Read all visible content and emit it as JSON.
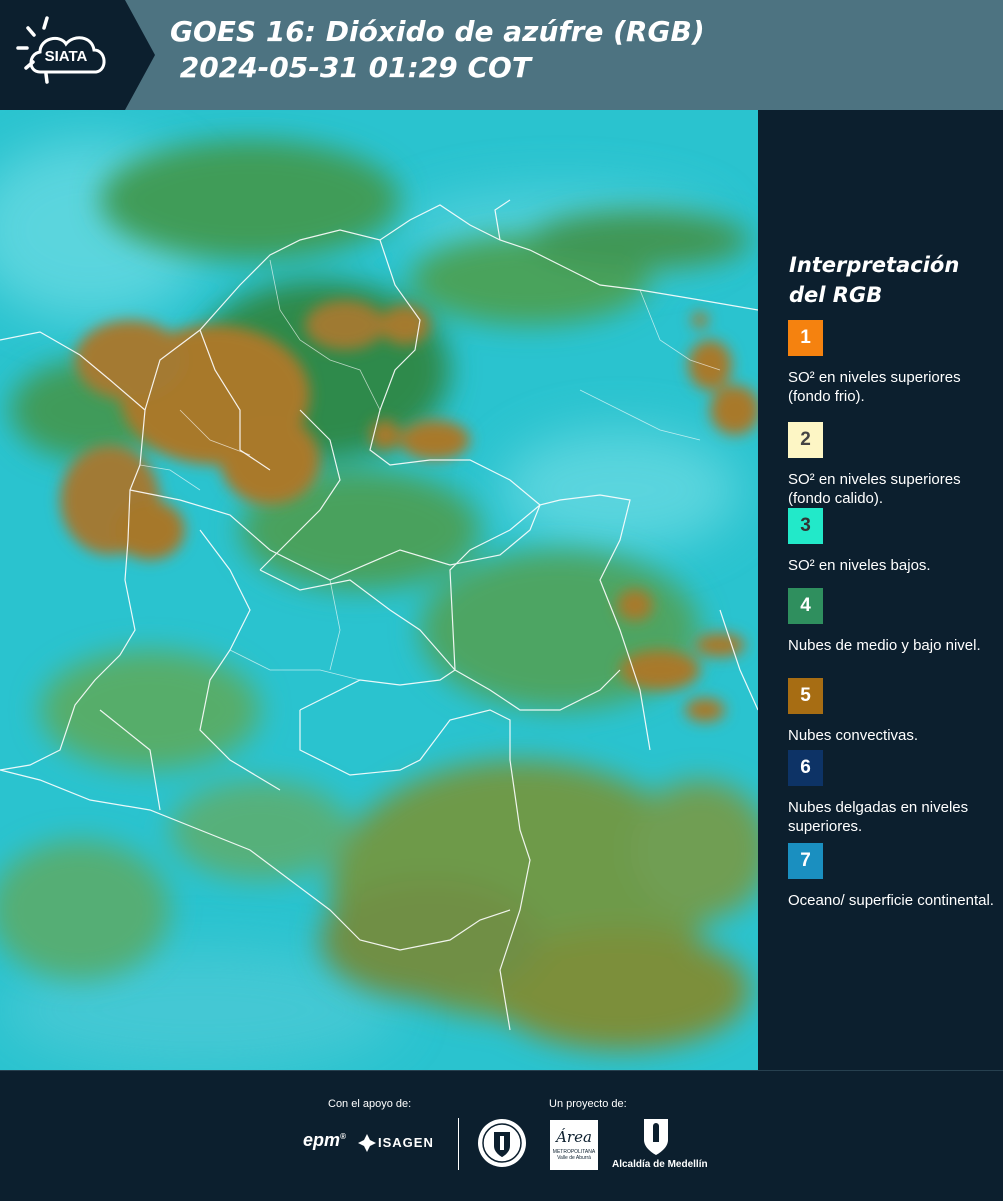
{
  "header": {
    "logo_text": "SIATA",
    "title_line1": "GOES 16: Dióxido de azúfre (RGB)",
    "title_line2": " 2024-05-31 01:29 COT"
  },
  "legend": {
    "title": "Interpretación del RGB",
    "items": [
      {
        "number": "1",
        "color": "#f5820f",
        "text_color": "#ffffff",
        "label": "SO² en niveles superiores (fondo frio)."
      },
      {
        "number": "2",
        "color": "#fdf6c5",
        "text_color": "#444444",
        "label": "SO² en niveles superiores (fondo calido)."
      },
      {
        "number": "3",
        "color": "#22e9c9",
        "text_color": "#333333",
        "label": "SO² en niveles bajos."
      },
      {
        "number": "4",
        "color": "#2f8f5e",
        "text_color": "#ffffff",
        "label": "Nubes de medio y bajo nivel."
      },
      {
        "number": "5",
        "color": "#a76d13",
        "text_color": "#ffffff",
        "label": "Nubes convectivas."
      },
      {
        "number": "6",
        "color": "#0d3366",
        "text_color": "#ffffff",
        "label": "Nubes delgadas en niveles superiores."
      },
      {
        "number": "7",
        "color": "#1a8fc0",
        "text_color": "#ffffff",
        "label": "Oceano/ superficie continental."
      }
    ]
  },
  "footer": {
    "support_label": "Con el apoyo de:",
    "project_label": "Un proyecto de:",
    "epm": "epm",
    "isagen": "ISAGEN",
    "area_logo": "Área",
    "area_sub1": "METROPOLITANA",
    "area_sub2": "Valle de Aburrá",
    "alcaldia": "Alcaldía de Medellín"
  },
  "colors": {
    "header_bg": "#4d7381",
    "page_bg": "#0c1f2e",
    "map_base": "#27c4cf",
    "cloud_green": "#3a9a55",
    "convective_brown": "#a8792a"
  }
}
